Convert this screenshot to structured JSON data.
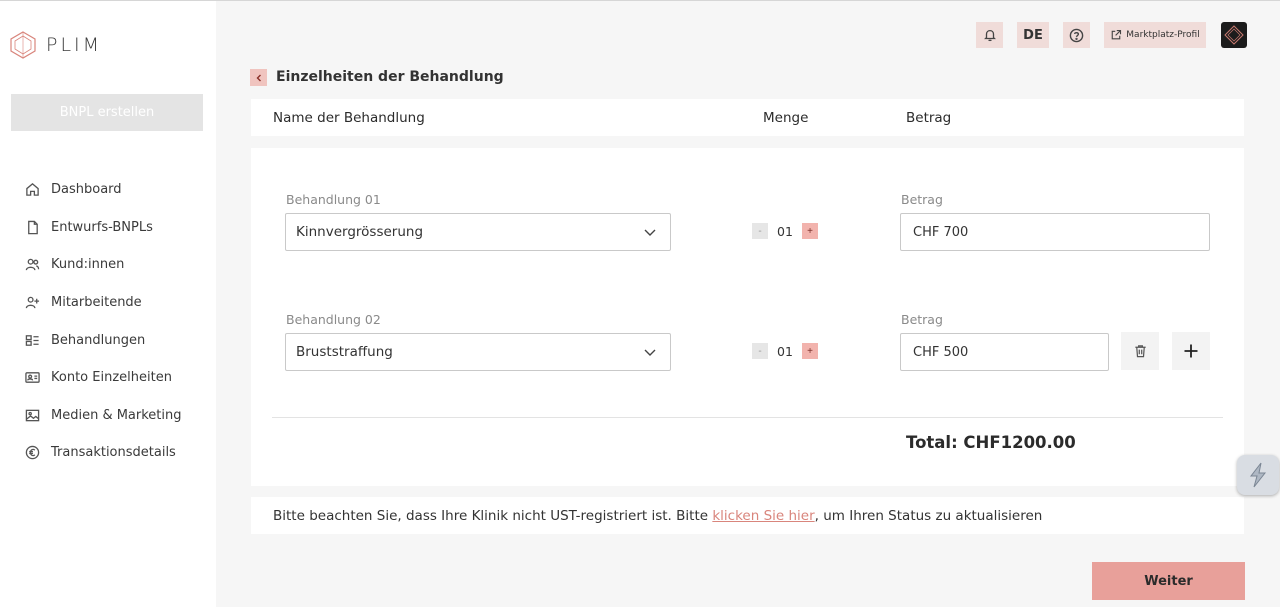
{
  "brand": {
    "name": "PLIM"
  },
  "sidebar": {
    "create_label": "BNPL erstellen",
    "items": [
      {
        "label": "Dashboard",
        "icon": "home-icon"
      },
      {
        "label": "Entwurfs-BNPLs",
        "icon": "document-icon"
      },
      {
        "label": "Kund:innen",
        "icon": "users-icon"
      },
      {
        "label": "Mitarbeitende",
        "icon": "user-plus-icon"
      },
      {
        "label": "Behandlungen",
        "icon": "treatment-icon"
      },
      {
        "label": "Konto Einzelheiten",
        "icon": "id-card-icon"
      },
      {
        "label": "Medien & Marketing",
        "icon": "image-icon"
      },
      {
        "label": "Transaktionsdetails",
        "icon": "euro-icon"
      }
    ]
  },
  "header": {
    "language": "DE",
    "marketplace_label": "Marktplatz-Profil"
  },
  "page": {
    "title": "Einzelheiten der Behandlung",
    "columns": {
      "name": "Name der Behandlung",
      "qty": "Menge",
      "amount": "Betrag"
    },
    "treatments": [
      {
        "label": "Behandlung 01",
        "name": "Kinnvergrösserung",
        "qty": "01",
        "amount_label": "Betrag",
        "amount": "CHF 700",
        "minus": "-",
        "plus": "+"
      },
      {
        "label": "Behandlung 02",
        "name": "Bruststraffung",
        "qty": "01",
        "amount_label": "Betrag",
        "amount": "CHF 500",
        "minus": "-",
        "plus": "+"
      }
    ],
    "total": "Total: CHF1200.00",
    "notice": {
      "before": "Bitte beachten Sie, dass Ihre Klinik nicht UST-registriert ist. Bitte ",
      "link": "klicken Sie hier",
      "after": ", um Ihren Status zu aktualisieren"
    },
    "next_label": "Weiter"
  },
  "colors": {
    "accent": "#e8a09a",
    "accent_light": "#f0dcd9",
    "link": "#d9857c"
  }
}
